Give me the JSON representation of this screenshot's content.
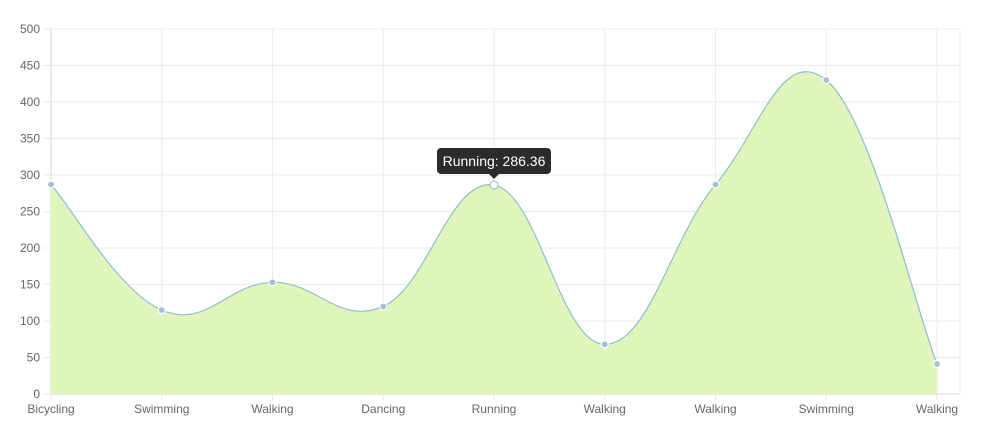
{
  "chart_data": {
    "type": "area",
    "categories": [
      "Bicycling",
      "Swimming",
      "Walking",
      "Dancing",
      "Running",
      "Walking",
      "Walking",
      "Swimming",
      "Walking"
    ],
    "series": [
      {
        "values": [
          287,
          115,
          153,
          120,
          286.36,
          68,
          287,
          430,
          41
        ]
      }
    ],
    "ylim": [
      0,
      500
    ],
    "yticks": [
      0,
      50,
      100,
      150,
      200,
      250,
      300,
      350,
      400,
      450,
      500
    ],
    "grid": true,
    "title": "",
    "xlabel": "",
    "ylabel": "",
    "colors": {
      "fill": "#e0f5bb",
      "line": "#8fbfcb",
      "point_fill": "#a4bfd6",
      "point_stroke": "#ffffff",
      "grid": "#ebebeb",
      "tooltip_bg": "#2b2b2b"
    },
    "tooltip": {
      "index": 4,
      "text": "Running: 286.36"
    }
  }
}
